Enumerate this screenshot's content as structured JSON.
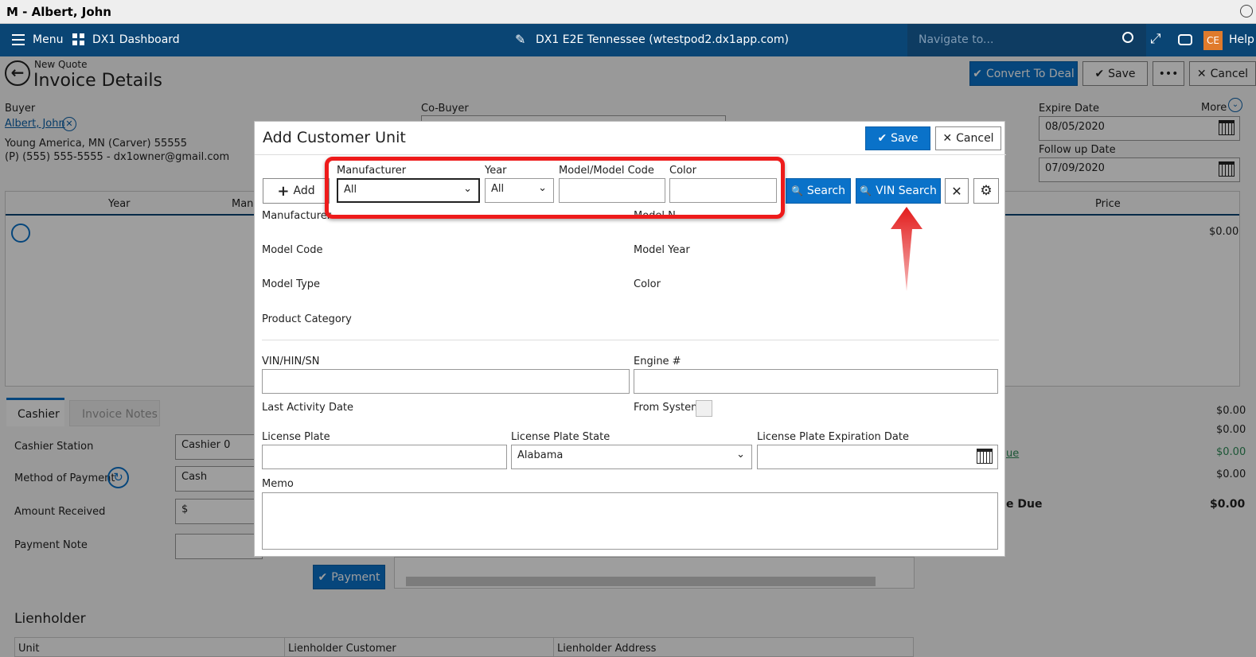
{
  "window": {
    "title": "M - Albert, John"
  },
  "topnav": {
    "menu_label": "Menu",
    "dashboard_label": "DX1 Dashboard",
    "site_label": "DX1 E2E Tennessee (wtestpod2.dx1app.com)",
    "navigate_placeholder": "Navigate to...",
    "user_initials": "CE",
    "help_label": "Help"
  },
  "page": {
    "breadcrumb": "New Quote",
    "title": "Invoice Details",
    "actions": {
      "convert": "Convert To Deal",
      "save": "Save",
      "more": "•••",
      "cancel": "Cancel"
    },
    "buyer": {
      "label": "Buyer",
      "name": "Albert, John",
      "address": "Young America, MN (Carver) 55555",
      "contact": "(P) (555) 555-5555 - dx1owner@gmail.com"
    },
    "cobuyer_label": "Co-Buyer",
    "more_label": "More",
    "expire_date": {
      "label": "Expire Date",
      "value": "08/05/2020"
    },
    "followup_date": {
      "label": "Follow up Date",
      "value": "07/09/2020"
    },
    "grid": {
      "col_year": "Year",
      "col_manu": "Manu",
      "col_price": "Price",
      "price_value": "$0.00"
    },
    "tabs": [
      "Cashier",
      "Invoice Notes"
    ],
    "cashier": {
      "station_label": "Cashier Station",
      "station_value": "Cashier 0",
      "payment_method_label": "Method of Payment",
      "payment_method_value": "Cash",
      "amount_label": "Amount Received",
      "currency": "$",
      "note_label": "Payment Note",
      "payment_button": "Payment"
    },
    "totals": {
      "v1": "$0.00",
      "v2": "$0.00",
      "link": "ue",
      "v3": "$0.00",
      "v4": "$0.00",
      "due_label": "e Due",
      "due_value": "$0.00"
    },
    "lienholder": {
      "title": "Lienholder",
      "cols": [
        "Unit",
        "Lienholder Customer",
        "Lienholder Address"
      ]
    }
  },
  "modal": {
    "title": "Add Customer Unit",
    "save": "Save",
    "cancel": "Cancel",
    "add": "Add",
    "filters": {
      "manufacturer_label": "Manufacturer",
      "manufacturer_value": "All",
      "year_label": "Year",
      "year_value": "All",
      "model_label": "Model/Model Code",
      "model_value": "",
      "color_label": "Color",
      "color_value": ""
    },
    "search": "Search",
    "vin_search": "VIN Search",
    "details": {
      "manufacturer": "Manufacturer",
      "model_name": "Model N",
      "model_code": "Model Code",
      "model_year": "Model Year",
      "model_type": "Model Type",
      "color": "Color",
      "product_category": "Product Category"
    },
    "form": {
      "vin_label": "VIN/HIN/SN",
      "vin_value": "",
      "engine_label": "Engine #",
      "engine_value": "",
      "last_activity_label": "Last Activity Date",
      "from_system_label": "From System",
      "plate_label": "License Plate",
      "plate_value": "",
      "plate_state_label": "License Plate State",
      "plate_state_value": "Alabama",
      "plate_exp_label": "License Plate Expiration Date",
      "plate_exp_value": "",
      "memo_label": "Memo",
      "memo_value": ""
    }
  },
  "colors": {
    "nav_bg": "#0a4574",
    "accent_blue": "#0a72c9",
    "highlight_red": "#ee1b1b"
  },
  "icons": [
    "hamburger-icon",
    "grid-icon",
    "pencil-icon",
    "search-icon",
    "expand-icon",
    "chat-icon",
    "back-arrow-icon",
    "check-icon",
    "close-icon",
    "calendar-icon",
    "plus-icon",
    "gear-icon",
    "chevron-down-icon",
    "magnifier-circle-icon",
    "refresh-circle-icon",
    "red-arrow-icon"
  ]
}
